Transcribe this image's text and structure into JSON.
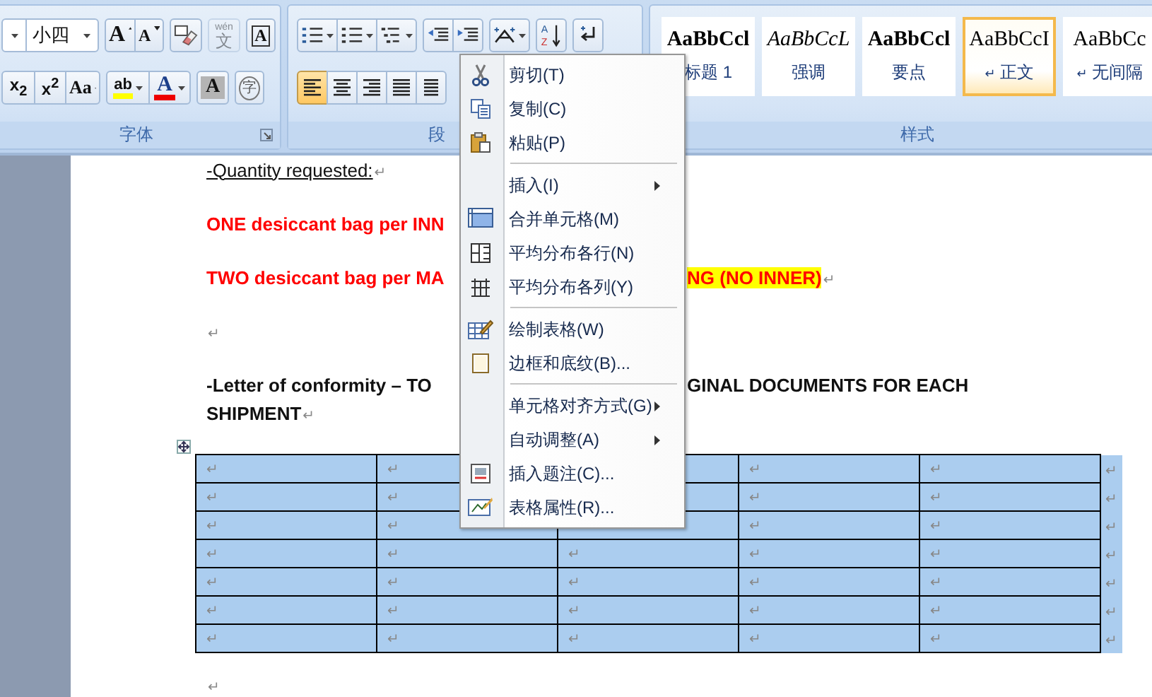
{
  "font_group": {
    "label": "字体",
    "rows": [
      [
        [
          {
            "kind": "font-name",
            "disabled": false
          },
          {
            "kind": "font-size",
            "label": "小四",
            "disabled": false
          }
        ],
        [
          {
            "kind": "grow",
            "label": "A",
            "disabled": false
          },
          {
            "kind": "shrink",
            "label": "A",
            "disabled": false
          }
        ],
        [
          {
            "kind": "clear",
            "disabled": false
          }
        ],
        [
          {
            "kind": "phonetic",
            "pinyin": "wén",
            "label": "文",
            "disabled": true
          }
        ],
        [
          {
            "kind": "border",
            "label": "A",
            "disabled": false
          }
        ]
      ],
      [
        [
          {
            "kind": "subscript",
            "label": "x$_{2}$",
            "disabled": false
          },
          {
            "kind": "superscript",
            "label": "x$^{2}$",
            "disabled": false
          },
          {
            "kind": "case",
            "label": "Aa",
            "disabled": false
          }
        ],
        [
          {
            "kind": "highlight",
            "label": "ab",
            "disabled": false
          },
          {
            "kind": "fontcolor",
            "label": "A",
            "disabled": false
          }
        ],
        [
          {
            "kind": "shade",
            "label": "A",
            "disabled": false
          }
        ],
        [
          {
            "kind": "enclose",
            "label": "字",
            "disabled": false
          }
        ]
      ]
    ]
  },
  "paragraph_group": {
    "label": "段",
    "rows": [
      [
        [
          {
            "kind": "bullets"
          },
          {
            "kind": "numbering"
          },
          {
            "kind": "multilevel"
          }
        ],
        [
          {
            "kind": "outdent"
          },
          {
            "kind": "indent"
          }
        ],
        [
          {
            "kind": "asian-layout"
          }
        ],
        [
          {
            "kind": "sort",
            "label_top": "A",
            "label_bottom": "Z"
          }
        ],
        [
          {
            "kind": "show-marks"
          }
        ]
      ],
      [
        [
          {
            "kind": "align-left",
            "selected": true
          },
          {
            "kind": "align-center",
            "selected": false
          },
          {
            "kind": "align-right",
            "selected": false
          },
          {
            "kind": "justify",
            "selected": false
          },
          {
            "kind": "distribute",
            "selected": false
          }
        ]
      ]
    ]
  },
  "styles_group": {
    "label": "样式",
    "styles": [
      {
        "preview": "AaBbCcl",
        "name": "标题 1",
        "kind": "heading",
        "selected": false
      },
      {
        "preview": "AaBbCcL",
        "name": "强调",
        "kind": "emphasis",
        "selected": false
      },
      {
        "preview": "AaBbCcl",
        "name": "要点",
        "kind": "strong",
        "selected": false
      },
      {
        "preview": "AaBbCcI",
        "name": "正文",
        "mark": "↵",
        "kind": "normal",
        "selected": true
      },
      {
        "preview": "AaBbCc",
        "name": "无间隔",
        "mark": "↵",
        "kind": "normal",
        "selected": false
      }
    ]
  },
  "document": {
    "paragraphs": [
      {
        "kind": "underlined",
        "lines": [
          {
            "left": "-Quantity requested:",
            "mark": "↵"
          }
        ]
      },
      {
        "kind": "red",
        "lines": [
          {
            "left": "ONE desiccant bag per INN"
          }
        ]
      },
      {
        "kind": "red",
        "lines": [
          {
            "left": "TWO desiccant bag per MA",
            "right": "NG (NO INNER)",
            "highlighted": true,
            "mark": "↵"
          }
        ]
      },
      {
        "kind": "plain",
        "lines": [
          {
            "mark": "↵"
          }
        ]
      },
      {
        "kind": "bold",
        "lines": [
          {
            "left": "-Letter of conformity – TO",
            "right": "GINAL DOCUMENTS FOR EACH"
          },
          {
            "left": "SHIPMENT",
            "mark": "↵"
          }
        ]
      }
    ],
    "table": {
      "selected": true,
      "rows": [
        {
          "cells": [
            "↵",
            "↵",
            null,
            "↵",
            "↵"
          ],
          "end": "↵"
        },
        {
          "cells": [
            "↵",
            "↵",
            null,
            "↵",
            "↵"
          ],
          "end": "↵"
        },
        {
          "cells": [
            "↵",
            "↵",
            null,
            "↵",
            "↵"
          ],
          "end": "↵"
        },
        {
          "cells": [
            "↵",
            "↵",
            "↵",
            "↵",
            "↵"
          ],
          "end": "↵"
        },
        {
          "cells": [
            "↵",
            "↵",
            "↵",
            "↵",
            "↵"
          ],
          "end": "↵"
        },
        {
          "cells": [
            "↵",
            "↵",
            "↵",
            "↵",
            "↵"
          ],
          "end": "↵"
        },
        {
          "cells": [
            "↵",
            "↵",
            "↵",
            "↵",
            "↵"
          ],
          "end": "↵"
        }
      ]
    },
    "trailing_mark": "↵"
  },
  "context_menu": {
    "items": [
      {
        "kind": "item",
        "label": "剪切(T)",
        "submenu": false
      },
      {
        "kind": "item",
        "label": "复制(C)",
        "submenu": false
      },
      {
        "kind": "item",
        "label": "粘贴(P)",
        "submenu": false
      },
      {
        "kind": "separator"
      },
      {
        "kind": "item",
        "label": "插入(I)",
        "submenu": true
      },
      {
        "kind": "item",
        "label": "合并单元格(M)",
        "submenu": false
      },
      {
        "kind": "item",
        "label": "平均分布各行(N)",
        "submenu": false
      },
      {
        "kind": "item",
        "label": "平均分布各列(Y)",
        "submenu": false
      },
      {
        "kind": "separator"
      },
      {
        "kind": "item",
        "label": "绘制表格(W)",
        "submenu": false
      },
      {
        "kind": "item",
        "label": "边框和底纹(B)...",
        "submenu": false
      },
      {
        "kind": "separator"
      },
      {
        "kind": "item",
        "label": "单元格对齐方式(G)",
        "submenu": true
      },
      {
        "kind": "item",
        "label": "自动调整(A)",
        "submenu": true
      },
      {
        "kind": "item",
        "label": "插入题注(C)...",
        "submenu": false
      },
      {
        "kind": "item",
        "label": "表格属性(R)...",
        "submenu": false
      }
    ]
  }
}
